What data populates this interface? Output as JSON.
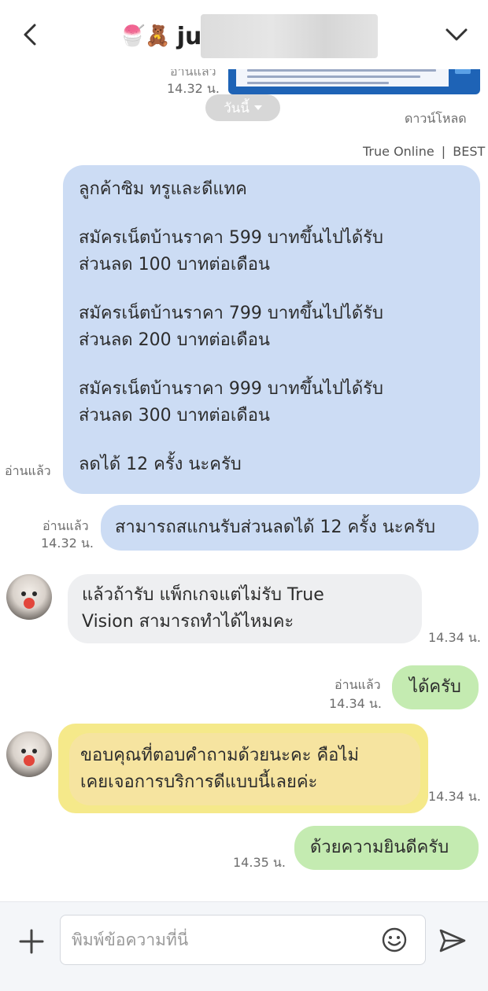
{
  "header": {
    "title_emoji": "🍧🧸",
    "title": "ju",
    "back_icon": "chevron-left-icon",
    "menu_icon": "chevron-down-icon"
  },
  "chat": {
    "prev": {
      "read_label": "อ่านแล้ว",
      "time": "14.32 น.",
      "download_label": "ดาวน์โหลด"
    },
    "date_pill": "วันนี้",
    "sender_tag": {
      "name": "True Online",
      "separator": "|",
      "suffix": "BEST"
    },
    "big_message": {
      "lines": [
        "ลูกค้าซิม ทรูและดีแทค",
        "สมัครเน็ตบ้านราคา 599 บาทขึ้นไปได้รับ",
        "ส่วนลด 100 บาทต่อเดือน",
        "สมัครเน็ตบ้านราคา 799 บาทขึ้นไปได้รับ",
        "ส่วนลด 200 บาทต่อเดือน",
        "สมัครเน็ตบ้านราคา 999 บาทขึ้นไปได้รับ",
        "ส่วนลด 300  บาทต่อเดือน",
        "ลดได้ 12 ครั้ง นะครับ"
      ],
      "read_label": "อ่านแล้ว"
    },
    "msg_scan": {
      "text": "สามารถสแกนรับส่วนลดได้ 12 ครั้ง นะครับ",
      "read_label": "อ่านแล้ว",
      "time": "14.32 น."
    },
    "msg_question": {
      "line1": "แล้วถ้ารับ แพ็กเกจแต่ไม่รับ  True",
      "line2": "Vision สามารถทำได้ไหมคะ",
      "time": "14.34 น."
    },
    "msg_yes": {
      "text": "ได้ครับ",
      "read_label": "อ่านแล้ว",
      "time": "14.34 น."
    },
    "msg_thanks": {
      "line1": "ขอบคุณที่ตอบคำถามด้วยนะคะ คือไม่",
      "line2": "เคยเจอการบริการดีแบบนี้เลยค่ะ",
      "time": "14.34 น."
    },
    "msg_welcome": {
      "text": "ด้วยความยินดีครับ",
      "time": "14.35 น."
    }
  },
  "composer": {
    "placeholder": "พิมพ์ข้อความที่นี่",
    "plus_icon": "plus-icon",
    "emoji_icon": "smiley-icon",
    "send_icon": "send-icon"
  },
  "colors": {
    "outgoing_blue": "#ccdcf4",
    "outgoing_green": "#c4ebb1",
    "incoming_gray": "#eeeff1",
    "highlight_yellow": "#f5e98a"
  }
}
